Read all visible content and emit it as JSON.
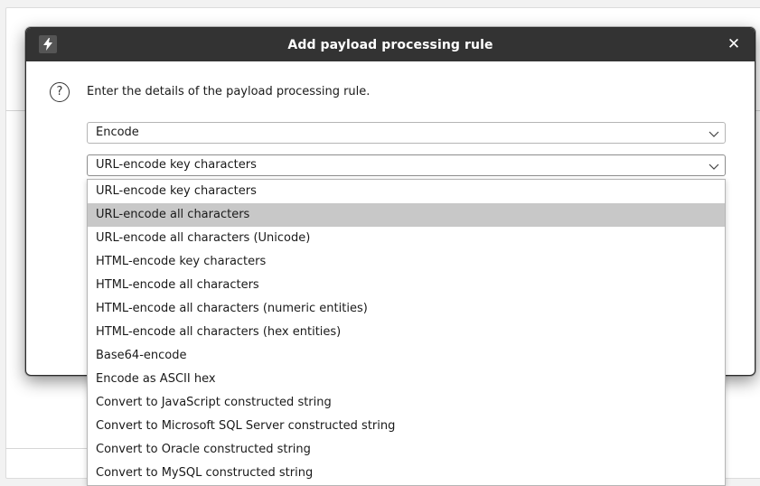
{
  "dialog": {
    "title": "Add payload processing rule",
    "close_symbol": "✕",
    "app_icon": "lightning-icon",
    "prompt": "Enter the details of the payload processing rule."
  },
  "rule_type": {
    "selected": "Encode"
  },
  "encode_type": {
    "selected": "URL-encode key characters",
    "highlighted_index": 1,
    "options": [
      "URL-encode key characters",
      "URL-encode all characters",
      "URL-encode all characters (Unicode)",
      "HTML-encode key characters",
      "HTML-encode all characters",
      "HTML-encode all characters (numeric entities)",
      "HTML-encode all characters (hex entities)",
      "Base64-encode",
      "Encode as ASCII hex",
      "Convert to JavaScript constructed string",
      "Convert to Microsoft SQL Server constructed string",
      "Convert to Oracle constructed string",
      "Convert to MySQL constructed string"
    ]
  },
  "colors": {
    "titlebar": "#333333",
    "highlight": "#c8c8c8"
  }
}
